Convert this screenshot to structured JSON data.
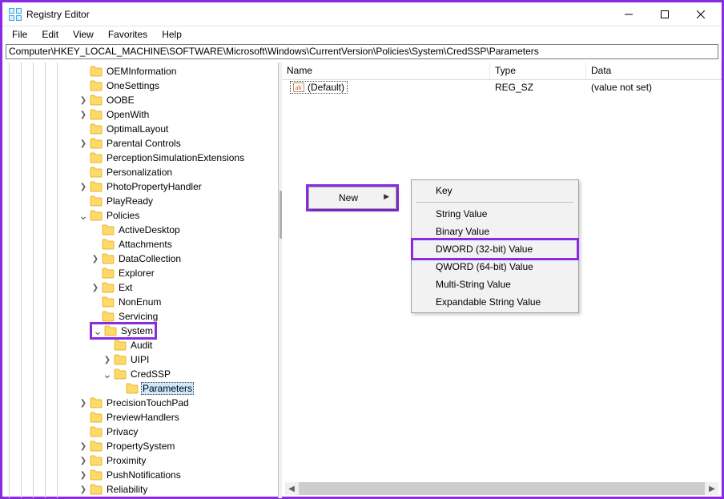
{
  "window": {
    "title": "Registry Editor"
  },
  "menu": {
    "items": [
      "File",
      "Edit",
      "View",
      "Favorites",
      "Help"
    ]
  },
  "address": "Computer\\HKEY_LOCAL_MACHINE\\SOFTWARE\\Microsoft\\Windows\\CurrentVersion\\Policies\\System\\CredSSP\\Parameters",
  "tree": {
    "nodes": [
      {
        "indent": 6,
        "tw": "",
        "label": "OEMInformation"
      },
      {
        "indent": 6,
        "tw": "",
        "label": "OneSettings"
      },
      {
        "indent": 6,
        "tw": ">",
        "label": "OOBE"
      },
      {
        "indent": 6,
        "tw": ">",
        "label": "OpenWith"
      },
      {
        "indent": 6,
        "tw": "",
        "label": "OptimalLayout"
      },
      {
        "indent": 6,
        "tw": ">",
        "label": "Parental Controls"
      },
      {
        "indent": 6,
        "tw": "",
        "label": "PerceptionSimulationExtensions"
      },
      {
        "indent": 6,
        "tw": "",
        "label": "Personalization"
      },
      {
        "indent": 6,
        "tw": ">",
        "label": "PhotoPropertyHandler"
      },
      {
        "indent": 6,
        "tw": "",
        "label": "PlayReady"
      },
      {
        "indent": 6,
        "tw": "v",
        "label": "Policies"
      },
      {
        "indent": 7,
        "tw": "",
        "label": "ActiveDesktop"
      },
      {
        "indent": 7,
        "tw": "",
        "label": "Attachments"
      },
      {
        "indent": 7,
        "tw": ">",
        "label": "DataCollection"
      },
      {
        "indent": 7,
        "tw": "",
        "label": "Explorer"
      },
      {
        "indent": 7,
        "tw": ">",
        "label": "Ext"
      },
      {
        "indent": 7,
        "tw": "",
        "label": "NonEnum"
      },
      {
        "indent": 7,
        "tw": "",
        "label": "Servicing"
      },
      {
        "indent": 7,
        "tw": "v",
        "label": "System",
        "hl": true
      },
      {
        "indent": 8,
        "tw": "",
        "label": "Audit"
      },
      {
        "indent": 8,
        "tw": ">",
        "label": "UIPI"
      },
      {
        "indent": 8,
        "tw": "v",
        "label": "CredSSP"
      },
      {
        "indent": 9,
        "tw": "",
        "label": "Parameters",
        "selected": true
      },
      {
        "indent": 6,
        "tw": ">",
        "label": "PrecisionTouchPad"
      },
      {
        "indent": 6,
        "tw": "",
        "label": "PreviewHandlers"
      },
      {
        "indent": 6,
        "tw": "",
        "label": "Privacy"
      },
      {
        "indent": 6,
        "tw": ">",
        "label": "PropertySystem"
      },
      {
        "indent": 6,
        "tw": ">",
        "label": "Proximity"
      },
      {
        "indent": 6,
        "tw": ">",
        "label": "PushNotifications"
      },
      {
        "indent": 6,
        "tw": ">",
        "label": "Reliability"
      }
    ]
  },
  "list": {
    "columns": [
      "Name",
      "Type",
      "Data"
    ],
    "rows": [
      {
        "name": "(Default)",
        "type": "REG_SZ",
        "data": "(value not set)"
      }
    ]
  },
  "context_primary": {
    "items": [
      {
        "label": "New",
        "sub": true,
        "hl": true
      }
    ]
  },
  "context_sub": {
    "items": [
      {
        "label": "Key"
      },
      {
        "sep": true
      },
      {
        "label": "String Value"
      },
      {
        "label": "Binary Value"
      },
      {
        "label": "DWORD (32-bit) Value",
        "hl": true
      },
      {
        "label": "QWORD (64-bit) Value"
      },
      {
        "label": "Multi-String Value"
      },
      {
        "label": "Expandable String Value"
      }
    ]
  }
}
